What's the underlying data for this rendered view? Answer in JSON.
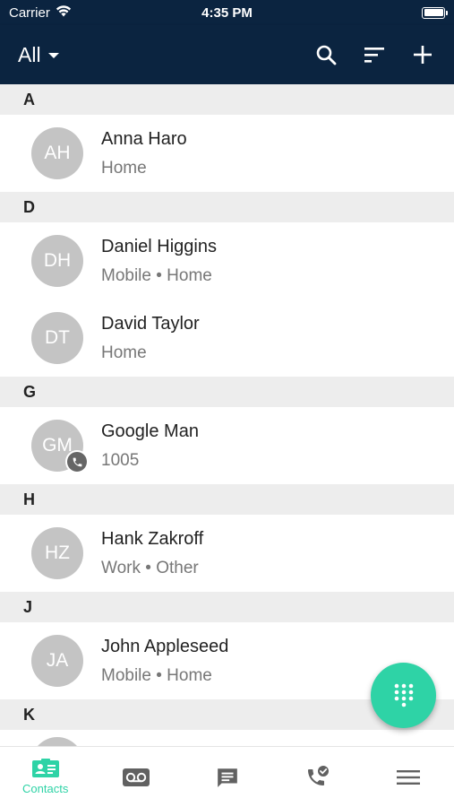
{
  "status_bar": {
    "carrier": "Carrier",
    "time": "4:35 PM"
  },
  "header": {
    "filter_label": "All",
    "colors": {
      "background": "#0b2440",
      "accent": "#2ed3a6"
    }
  },
  "sections": [
    {
      "letter": "A",
      "contacts": [
        {
          "initials": "AH",
          "name": "Anna Haro",
          "detail": "Home"
        }
      ]
    },
    {
      "letter": "D",
      "contacts": [
        {
          "initials": "DH",
          "name": "Daniel Higgins",
          "detail": "Mobile • Home"
        },
        {
          "initials": "DT",
          "name": "David Taylor",
          "detail": "Home"
        }
      ]
    },
    {
      "letter": "G",
      "contacts": [
        {
          "initials": "GM",
          "name": "Google Man",
          "detail": "1005",
          "badge_icon": "phone-icon"
        }
      ]
    },
    {
      "letter": "H",
      "contacts": [
        {
          "initials": "HZ",
          "name": "Hank Zakroff",
          "detail": "Work • Other"
        }
      ]
    },
    {
      "letter": "J",
      "contacts": [
        {
          "initials": "JA",
          "name": "John Appleseed",
          "detail": "Mobile • Home"
        }
      ]
    },
    {
      "letter": "K",
      "contacts": []
    }
  ],
  "fab": {
    "icon": "dialpad-icon"
  },
  "tabs": [
    {
      "label": "Contacts",
      "icon": "contacts-icon",
      "active": true
    },
    {
      "label": "",
      "icon": "voicemail-icon"
    },
    {
      "label": "",
      "icon": "messages-icon"
    },
    {
      "label": "",
      "icon": "call-history-icon"
    },
    {
      "label": "",
      "icon": "menu-icon"
    }
  ]
}
